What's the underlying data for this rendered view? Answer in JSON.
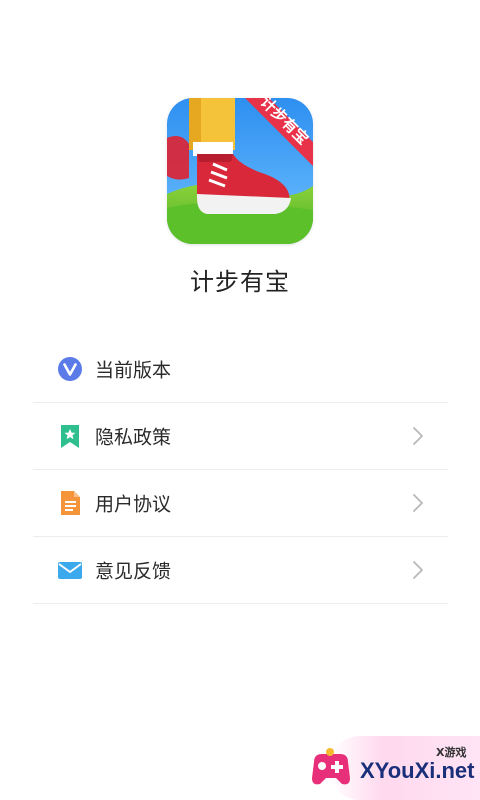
{
  "app": {
    "name": "计步有宝",
    "icon_badge_text": "计步有宝"
  },
  "menu": {
    "items": [
      {
        "label": "当前版本",
        "icon": "version-v-icon",
        "color": "#5b7be8",
        "has_chevron": false
      },
      {
        "label": "隐私政策",
        "icon": "bookmark-icon",
        "color": "#2fbf8f",
        "has_chevron": true
      },
      {
        "label": "用户协议",
        "icon": "document-icon",
        "color": "#f5943a",
        "has_chevron": true
      },
      {
        "label": "意见反馈",
        "icon": "mail-icon",
        "color": "#3ba9ec",
        "has_chevron": true
      }
    ]
  },
  "watermark": {
    "site": "XYouXi.net",
    "tag": "X游戏"
  },
  "colors": {
    "divider": "#ececec",
    "text": "#2a2a2a",
    "chevron": "#b8b8b8"
  }
}
